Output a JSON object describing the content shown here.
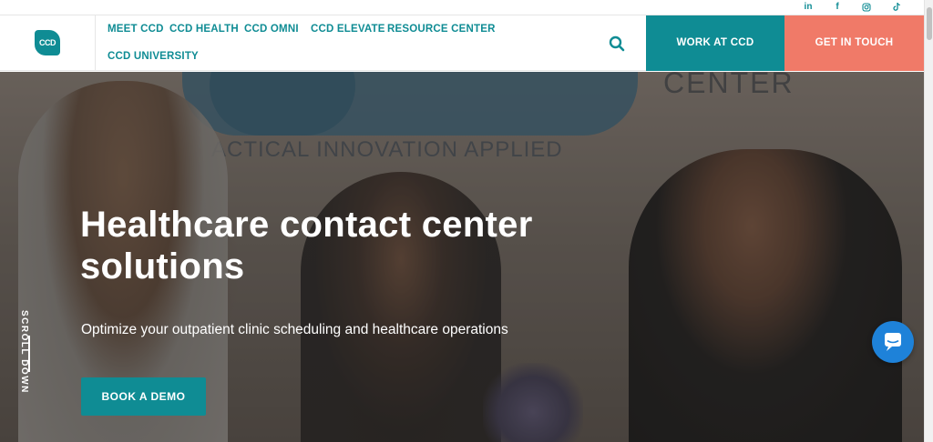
{
  "social": {
    "linkedin": "in",
    "facebook": "f",
    "icons": [
      "linkedin-icon",
      "facebook-icon",
      "instagram-icon",
      "tiktok-icon"
    ]
  },
  "header": {
    "logo_text": "CCD",
    "nav": [
      {
        "label": "MEET CCD"
      },
      {
        "label": "CCD HEALTH"
      },
      {
        "label": "CCD OMNI"
      },
      {
        "label": "CCD ELEVATE"
      },
      {
        "label": "RESOURCE CENTER"
      },
      {
        "label": "CCD UNIVERSITY"
      }
    ],
    "work_label": "WORK AT CCD",
    "touch_label": "GET IN TOUCH",
    "search_icon": "search-icon"
  },
  "hero": {
    "wall_text": "ACTICAL INNOVATION APPLIED",
    "wall_text_right": "CENTER",
    "title": "Healthcare contact center solutions",
    "subtitle": "Optimize your outpatient clinic scheduling and healthcare operations",
    "cta_label": "BOOK A DEMO",
    "scroll_label": "SCROLL DOWN"
  },
  "chat": {
    "icon": "chat-icon"
  },
  "colors": {
    "brand_teal": "#0f8c94",
    "coral": "#f07a68",
    "chat_blue": "#1e82d9"
  }
}
